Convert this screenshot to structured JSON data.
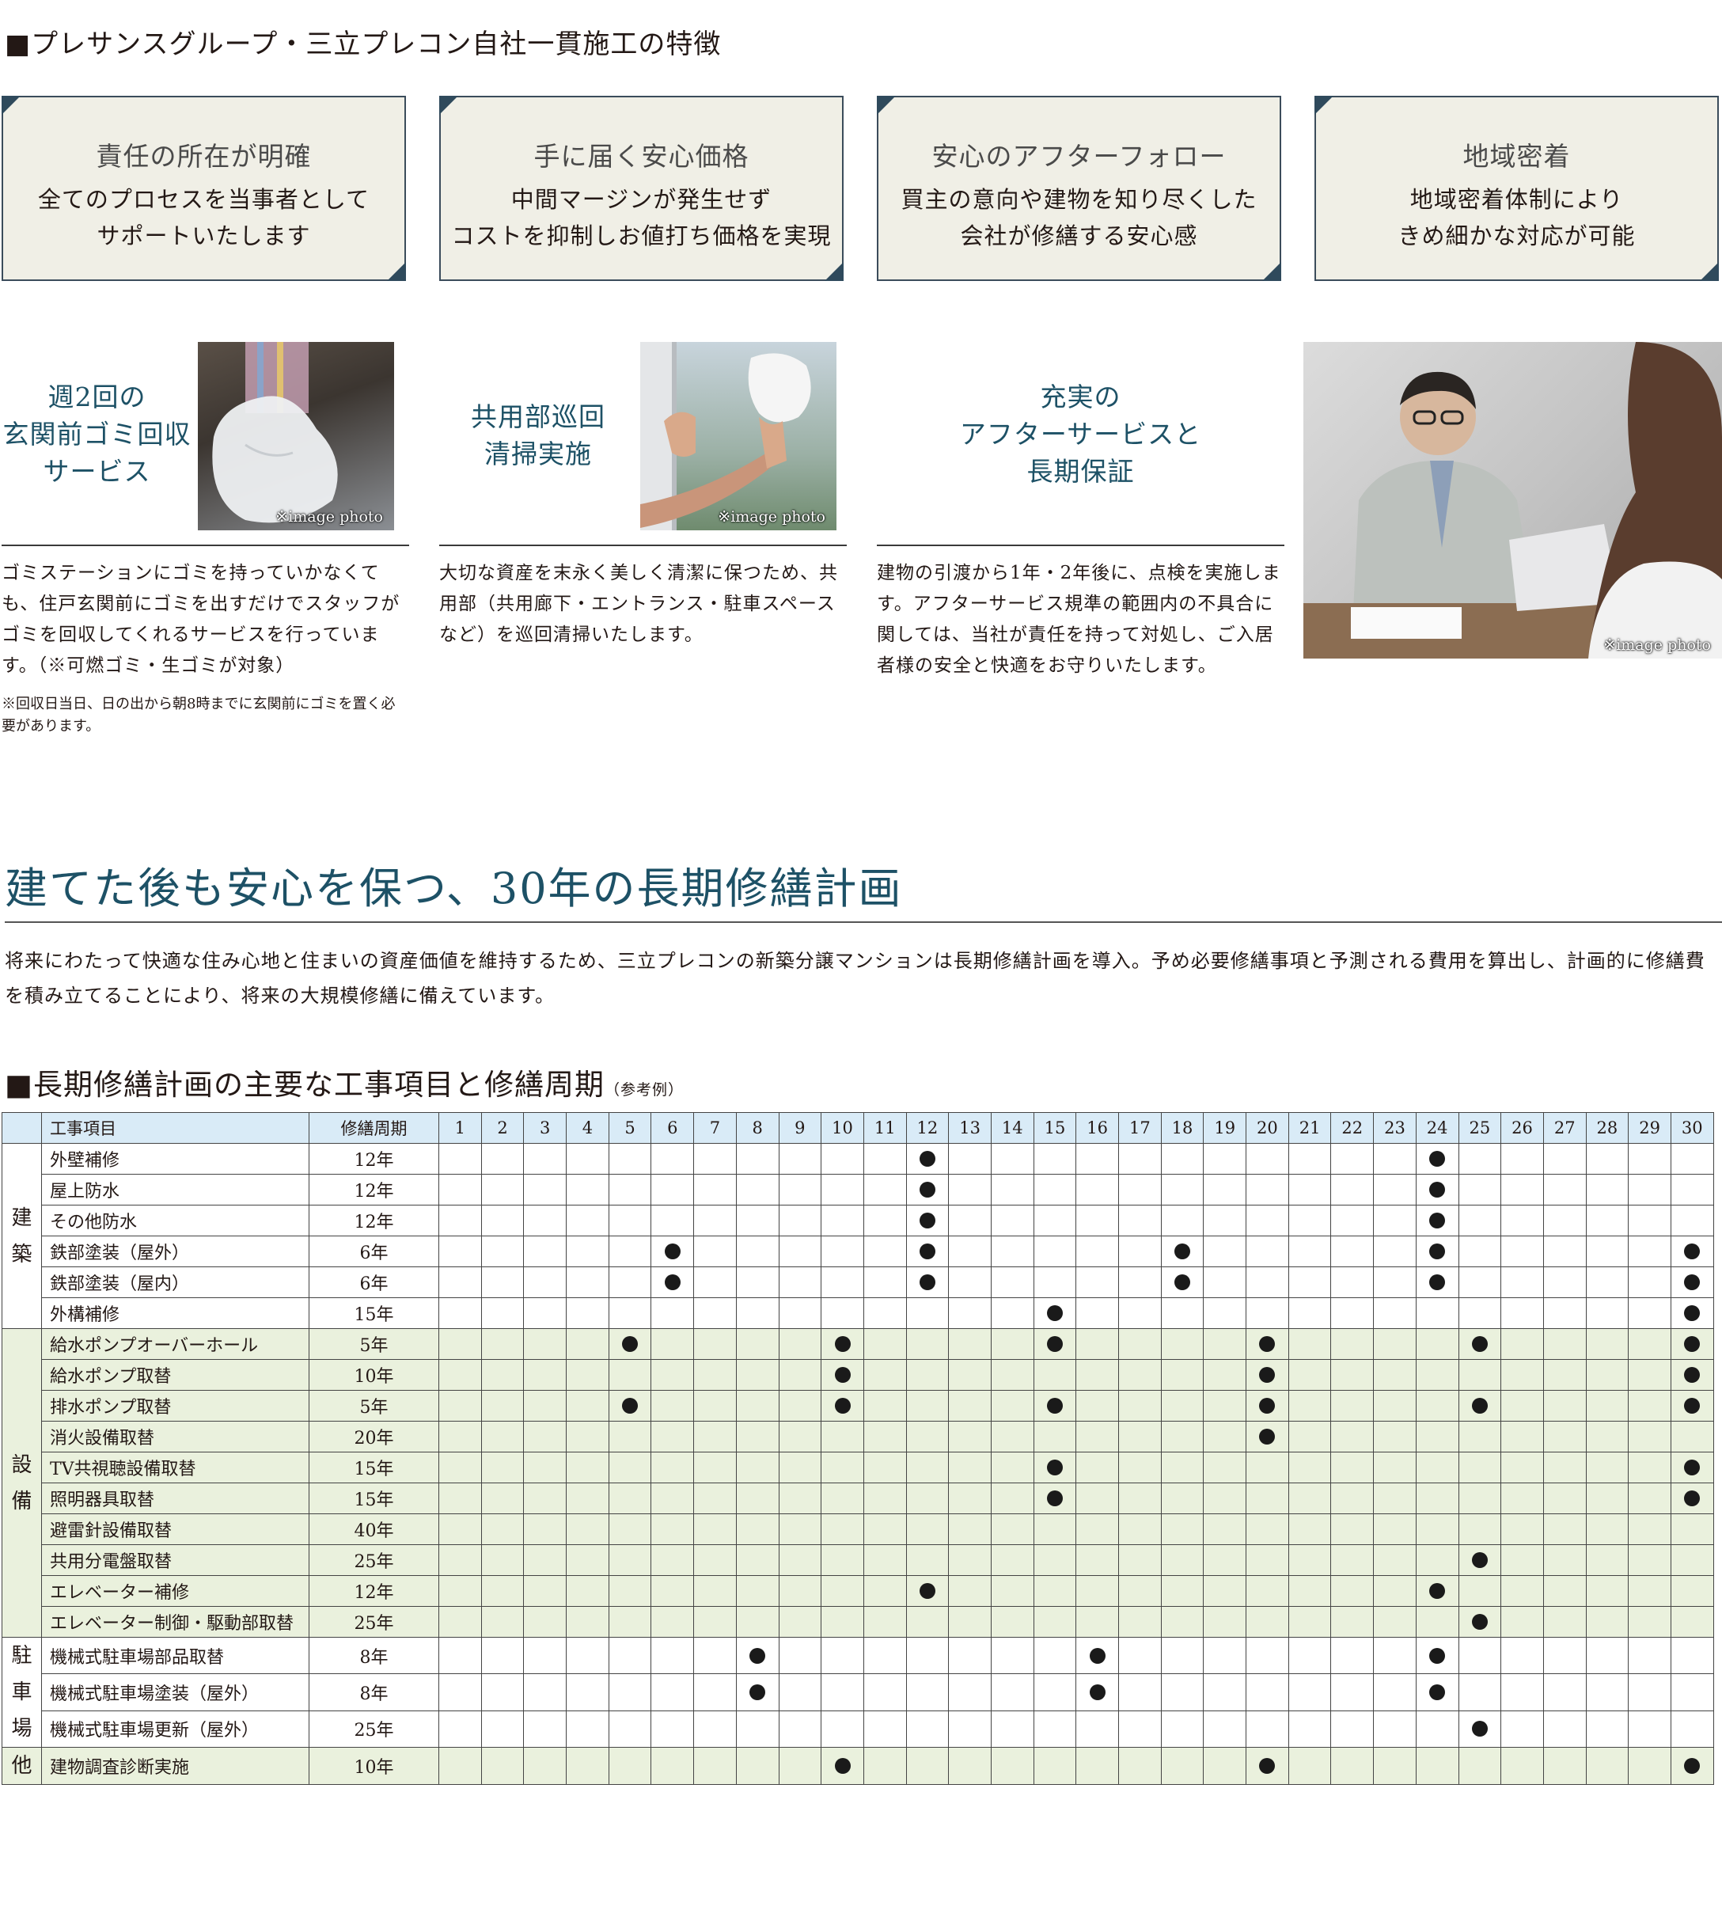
{
  "features_heading": "■プレサンスグループ・三立プレコン自社一貫施工の特徴",
  "features": [
    {
      "title": "責任の所在が明確",
      "line1": "全てのプロセスを当事者として",
      "line2": "サポートいたします"
    },
    {
      "title": "手に届く安心価格",
      "line1": "中間マージンが発生せず",
      "line2": "コストを抑制しお値打ち価格を実現"
    },
    {
      "title": "安心のアフターフォロー",
      "line1": "買主の意向や建物を知り尽くした",
      "line2": "会社が修繕する安心感"
    },
    {
      "title": "地域密着",
      "line1": "地域密着体制により",
      "line2": "きめ細かな対応が可能"
    }
  ],
  "services": [
    {
      "title_lines": [
        "週2回の",
        "玄関前ゴミ回収",
        "サービス"
      ],
      "photo_caption": "※image photo",
      "description": "ゴミステーションにゴミを持っていかなくても、住戸玄関前にゴミを出すだけでスタッフがゴミを回収してくれるサービスを行っています。（※可燃ゴミ・生ゴミが対象）",
      "note": "※回収日当日、日の出から朝8時までに玄関前にゴミを置く必要があります。"
    },
    {
      "title_lines": [
        "共用部巡回",
        "清掃実施"
      ],
      "photo_caption": "※image photo",
      "description": "大切な資産を末永く美しく清潔に保つため、共用部（共用廊下・エントランス・駐車スペースなど）を巡回清掃いたします。"
    },
    {
      "title_lines": [
        "充実の",
        "アフターサービスと",
        "長期保証"
      ],
      "description": "建物の引渡から1年・2年後に、点検を実施します。アフターサービス規準の範囲内の不具合に関しては、当社が責任を持って対処し、ご入居者様の安全と快適をお守りいたします。"
    }
  ],
  "main_photo_caption": "※image photo",
  "plan_title": "建てた後も安心を保つ、30年の長期修繕計画",
  "plan_intro": "将来にわたって快適な住み心地と住まいの資産価値を維持するため、三立プレコンの新築分譲マンションは長期修繕計画を導入。予め必要修繕事項と予測される費用を算出し、計画的に修繕費を積み立てることにより、将来の大規模修繕に備えています。",
  "table_heading": "■長期修繕計画の主要な工事項目と修繕周期",
  "table_heading_note": "（参考例）",
  "table": {
    "col_item": "工事項目",
    "col_cycle": "修繕周期",
    "years": [
      1,
      2,
      3,
      4,
      5,
      6,
      7,
      8,
      9,
      10,
      11,
      12,
      13,
      14,
      15,
      16,
      17,
      18,
      19,
      20,
      21,
      22,
      23,
      24,
      25,
      26,
      27,
      28,
      29,
      30
    ],
    "groups": [
      {
        "label": "建\n築",
        "shade": false,
        "rows": [
          {
            "item": "外壁補修",
            "cycle": "12年",
            "marks": [
              12,
              24
            ]
          },
          {
            "item": "屋上防水",
            "cycle": "12年",
            "marks": [
              12,
              24
            ]
          },
          {
            "item": "その他防水",
            "cycle": "12年",
            "marks": [
              12,
              24
            ]
          },
          {
            "item": "鉄部塗装（屋外）",
            "cycle": "6年",
            "marks": [
              6,
              12,
              18,
              24,
              30
            ]
          },
          {
            "item": "鉄部塗装（屋内）",
            "cycle": "6年",
            "marks": [
              6,
              12,
              18,
              24,
              30
            ]
          },
          {
            "item": "外構補修",
            "cycle": "15年",
            "marks": [
              15,
              30
            ]
          }
        ]
      },
      {
        "label": "設\n備",
        "shade": true,
        "rows": [
          {
            "item": "給水ポンプオーバーホール",
            "cycle": "5年",
            "marks": [
              5,
              10,
              15,
              20,
              25,
              30
            ]
          },
          {
            "item": "給水ポンプ取替",
            "cycle": "10年",
            "marks": [
              10,
              20,
              30
            ]
          },
          {
            "item": "排水ポンプ取替",
            "cycle": "5年",
            "marks": [
              5,
              10,
              15,
              20,
              25,
              30
            ]
          },
          {
            "item": "消火設備取替",
            "cycle": "20年",
            "marks": [
              20
            ]
          },
          {
            "item": "TV共視聴設備取替",
            "cycle": "15年",
            "marks": [
              15,
              30
            ]
          },
          {
            "item": "照明器具取替",
            "cycle": "15年",
            "marks": [
              15,
              30
            ]
          },
          {
            "item": "避雷針設備取替",
            "cycle": "40年",
            "marks": []
          },
          {
            "item": "共用分電盤取替",
            "cycle": "25年",
            "marks": [
              25
            ]
          },
          {
            "item": "エレベーター補修",
            "cycle": "12年",
            "marks": [
              12,
              24
            ]
          },
          {
            "item": "エレベーター制御・駆動部取替",
            "cycle": "25年",
            "marks": [
              25
            ]
          }
        ]
      },
      {
        "label": "駐\n車\n場",
        "shade": false,
        "rows": [
          {
            "item": "機械式駐車場部品取替",
            "cycle": "8年",
            "marks": [
              8,
              16,
              24
            ]
          },
          {
            "item": "機械式駐車場塗装（屋外）",
            "cycle": "8年",
            "marks": [
              8,
              16,
              24
            ]
          },
          {
            "item": "機械式駐車場更新（屋外）",
            "cycle": "25年",
            "marks": [
              25
            ]
          }
        ]
      },
      {
        "label": "他",
        "shade": true,
        "rows": [
          {
            "item": "建物調査診断実施",
            "cycle": "10年",
            "marks": [
              10,
              20,
              30
            ]
          }
        ]
      }
    ]
  }
}
